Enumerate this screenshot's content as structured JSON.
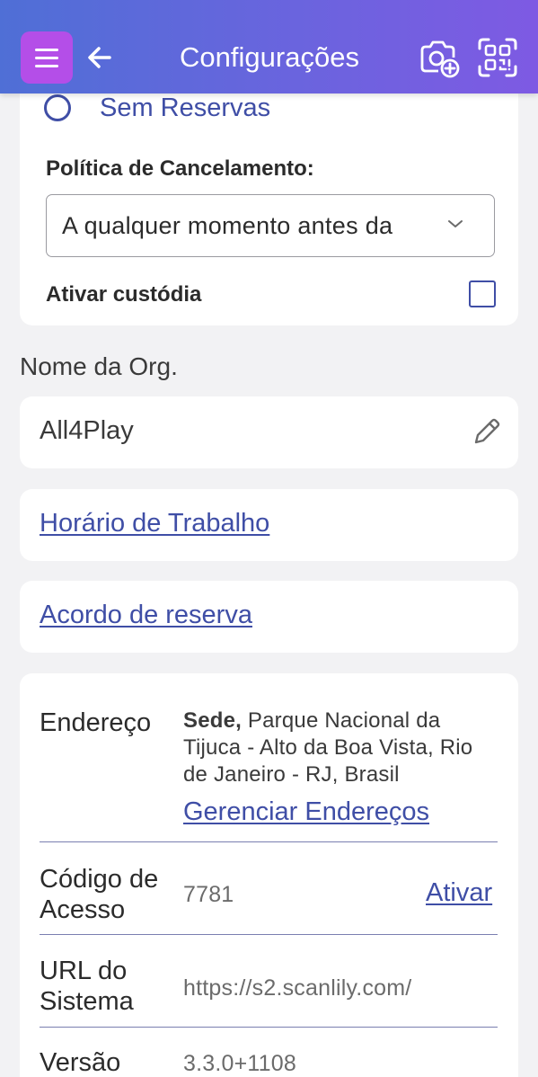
{
  "header": {
    "title": "Configurações",
    "menu_icon": "hamburger-icon",
    "back_icon": "arrow-left-icon",
    "camera_icon": "camera-add-icon",
    "qr_icon": "qr-scan-icon",
    "gradient_start": "#4f6fd6",
    "gradient_end": "#7e5ae3",
    "menu_button_color": "#b44ee8"
  },
  "reservation": {
    "radio_option_label": "Sem Reservas",
    "cancellation_label": "Política de Cancelamento:",
    "cancellation_value": "A qualquer momento antes da",
    "custody_label": "Ativar custódia",
    "custody_checked": false
  },
  "organization": {
    "heading": "Nome da Org.",
    "name": "All4Play"
  },
  "links": {
    "working_hours": "Horário de Trabalho",
    "booking_agreement": "Acordo de reserva"
  },
  "details": {
    "address_label": "Endereço",
    "address_prefix": "Sede,",
    "address_text": " Parque Nacional da Tijuca - Alto da Boa Vista, Rio de Janeiro - RJ, Brasil",
    "manage_addresses": "Gerenciar Endereços",
    "access_code_label_1": "Código de",
    "access_code_label_2": "Acesso",
    "access_code_value": "7781",
    "activate_label": "Ativar",
    "system_url_label_1": "URL do",
    "system_url_label_2": "Sistema",
    "system_url_value": "https://s2.scanlily.com/",
    "version_label": "Versão",
    "version_value": "3.3.0+1108"
  },
  "colors": {
    "accent": "#3f4ea6",
    "background": "#f2f2f4"
  }
}
